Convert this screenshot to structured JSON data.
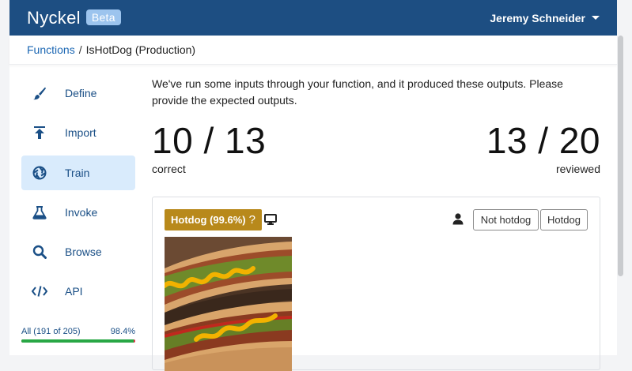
{
  "header": {
    "brand": "Nyckel",
    "badge": "Beta",
    "user": "Jeremy Schneider"
  },
  "breadcrumb": {
    "root": "Functions",
    "separator": "/",
    "current": "IsHotDog (Production)"
  },
  "sidebar": {
    "items": [
      {
        "label": "Define",
        "icon": "brush-icon",
        "active": false
      },
      {
        "label": "Import",
        "icon": "upload-icon",
        "active": false
      },
      {
        "label": "Train",
        "icon": "aperture-icon",
        "active": true
      },
      {
        "label": "Invoke",
        "icon": "flask-icon",
        "active": false
      },
      {
        "label": "Browse",
        "icon": "search-icon",
        "active": false
      },
      {
        "label": "API",
        "icon": "code-icon",
        "active": false
      }
    ],
    "progress": {
      "label": "All (191 of 205)",
      "percent_text": "98.4%",
      "fraction": 0.984
    }
  },
  "main": {
    "intro": "We've run some inputs through your function, and it produced these outputs. Please provide the expected outputs.",
    "correct": {
      "value": "10 / 13",
      "label": "correct"
    },
    "reviewed": {
      "value": "13 / 20",
      "label": "reviewed"
    }
  },
  "card": {
    "prediction": "Hotdog (99.6%)",
    "prediction_help": "?",
    "prediction_color": "#b8891b",
    "buttons": {
      "not_hotdog": "Not hotdog",
      "hotdog": "Hotdog"
    },
    "image": "hotdog-photo"
  },
  "colors": {
    "topbar": "#1d4e82",
    "link": "#1a66b3",
    "active_nav": "#d9ebfc",
    "progress_good": "#28a745",
    "progress_bad": "#dc3545"
  }
}
